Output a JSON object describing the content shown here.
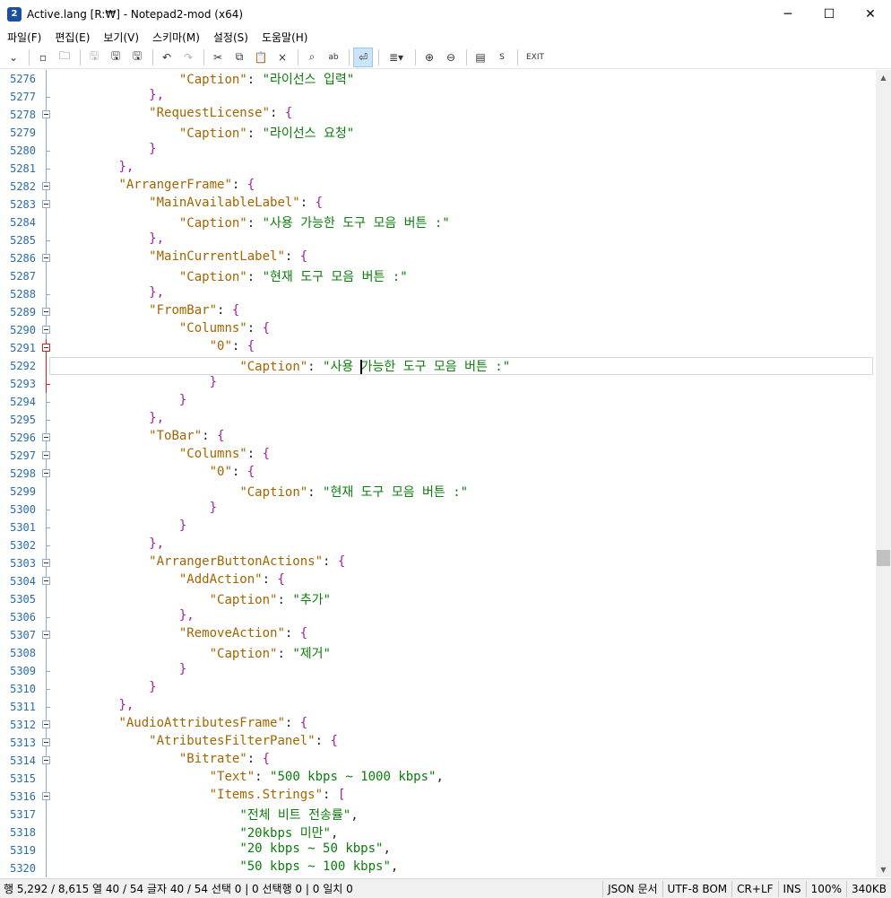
{
  "window": {
    "title": "Active.lang [R:₩] - Notepad2-mod (x64)",
    "app_icon_text": "2",
    "controls": {
      "minimize": "─",
      "maximize": "☐",
      "close": "✕"
    }
  },
  "menu": [
    "파일(F)",
    "편집(E)",
    "보기(V)",
    "스키마(M)",
    "설정(S)",
    "도움말(H)"
  ],
  "toolbar": {
    "dropdown_icon": "⌄",
    "new_icon": "▫",
    "open_icon": "🗀",
    "save_disabled_icon": "🖫",
    "save_icon": "🖫",
    "save_as_icon": "🖫",
    "undo_icon": "↶",
    "redo_icon": "↷",
    "cut_icon": "✂",
    "copy_icon": "⧉",
    "paste_icon": "📋",
    "delete_icon": "×",
    "find_icon": "⌕",
    "replace_icon": "ab",
    "wordwrap_icon": "⏎",
    "schema_icon": "≣▾",
    "zoom_in_icon": "⊕",
    "zoom_out_icon": "⊖",
    "settings_icon": "▤",
    "s_label": "S",
    "exit_label": "EXIT"
  },
  "editor": {
    "lines": [
      {
        "num": "5276",
        "fold": "line",
        "indent": 16,
        "key": "\"Caption\"",
        "sep": ": ",
        "value": "\"라이선스 입력\"",
        "tail": ""
      },
      {
        "num": "5277",
        "fold": "end",
        "indent": 12,
        "key": "",
        "sep": "",
        "value": "",
        "tail": "},"
      },
      {
        "num": "5278",
        "fold": "box",
        "indent": 12,
        "key": "\"RequestLicense\"",
        "sep": ": ",
        "value": "",
        "tail": "{"
      },
      {
        "num": "5279",
        "fold": "line",
        "indent": 16,
        "key": "\"Caption\"",
        "sep": ": ",
        "value": "\"라이선스 요청\"",
        "tail": ""
      },
      {
        "num": "5280",
        "fold": "end",
        "indent": 12,
        "key": "",
        "sep": "",
        "value": "",
        "tail": "}"
      },
      {
        "num": "5281",
        "fold": "end",
        "indent": 8,
        "key": "",
        "sep": "",
        "value": "",
        "tail": "},"
      },
      {
        "num": "5282",
        "fold": "box",
        "indent": 8,
        "key": "\"ArrangerFrame\"",
        "sep": ": ",
        "value": "",
        "tail": "{"
      },
      {
        "num": "5283",
        "fold": "box",
        "indent": 12,
        "key": "\"MainAvailableLabel\"",
        "sep": ": ",
        "value": "",
        "tail": "{"
      },
      {
        "num": "5284",
        "fold": "line",
        "indent": 16,
        "key": "\"Caption\"",
        "sep": ": ",
        "value": "\"사용 가능한 도구 모음 버튼 :\"",
        "tail": ""
      },
      {
        "num": "5285",
        "fold": "end",
        "indent": 12,
        "key": "",
        "sep": "",
        "value": "",
        "tail": "},"
      },
      {
        "num": "5286",
        "fold": "box",
        "indent": 12,
        "key": "\"MainCurrentLabel\"",
        "sep": ": ",
        "value": "",
        "tail": "{"
      },
      {
        "num": "5287",
        "fold": "line",
        "indent": 16,
        "key": "\"Caption\"",
        "sep": ": ",
        "value": "\"현재 도구 모음 버튼 :\"",
        "tail": ""
      },
      {
        "num": "5288",
        "fold": "end",
        "indent": 12,
        "key": "",
        "sep": "",
        "value": "",
        "tail": "},"
      },
      {
        "num": "5289",
        "fold": "box",
        "indent": 12,
        "key": "\"FromBar\"",
        "sep": ": ",
        "value": "",
        "tail": "{"
      },
      {
        "num": "5290",
        "fold": "box",
        "indent": 16,
        "key": "\"Columns\"",
        "sep": ": ",
        "value": "",
        "tail": "{"
      },
      {
        "num": "5291",
        "fold": "boxred",
        "indent": 20,
        "key": "\"0\"",
        "sep": ": ",
        "value": "",
        "tail": "{"
      },
      {
        "num": "5292",
        "fold": "linered",
        "indent": 24,
        "key": "\"Caption\"",
        "sep": ": ",
        "value": "\"사용 ",
        "caret": true,
        "value2": "가능한 도구 모음 버튼 :\"",
        "tail": "",
        "current": true
      },
      {
        "num": "5293",
        "fold": "endred",
        "indent": 20,
        "key": "",
        "sep": "",
        "value": "",
        "tail": "}"
      },
      {
        "num": "5294",
        "fold": "end",
        "indent": 16,
        "key": "",
        "sep": "",
        "value": "",
        "tail": "}"
      },
      {
        "num": "5295",
        "fold": "end",
        "indent": 12,
        "key": "",
        "sep": "",
        "value": "",
        "tail": "},"
      },
      {
        "num": "5296",
        "fold": "box",
        "indent": 12,
        "key": "\"ToBar\"",
        "sep": ": ",
        "value": "",
        "tail": "{"
      },
      {
        "num": "5297",
        "fold": "box",
        "indent": 16,
        "key": "\"Columns\"",
        "sep": ": ",
        "value": "",
        "tail": "{"
      },
      {
        "num": "5298",
        "fold": "box",
        "indent": 20,
        "key": "\"0\"",
        "sep": ": ",
        "value": "",
        "tail": "{"
      },
      {
        "num": "5299",
        "fold": "line",
        "indent": 24,
        "key": "\"Caption\"",
        "sep": ": ",
        "value": "\"현재 도구 모음 버튼 :\"",
        "tail": ""
      },
      {
        "num": "5300",
        "fold": "end",
        "indent": 20,
        "key": "",
        "sep": "",
        "value": "",
        "tail": "}"
      },
      {
        "num": "5301",
        "fold": "end",
        "indent": 16,
        "key": "",
        "sep": "",
        "value": "",
        "tail": "}"
      },
      {
        "num": "5302",
        "fold": "end",
        "indent": 12,
        "key": "",
        "sep": "",
        "value": "",
        "tail": "},"
      },
      {
        "num": "5303",
        "fold": "box",
        "indent": 12,
        "key": "\"ArrangerButtonActions\"",
        "sep": ": ",
        "value": "",
        "tail": "{"
      },
      {
        "num": "5304",
        "fold": "box",
        "indent": 16,
        "key": "\"AddAction\"",
        "sep": ": ",
        "value": "",
        "tail": "{"
      },
      {
        "num": "5305",
        "fold": "line",
        "indent": 20,
        "key": "\"Caption\"",
        "sep": ": ",
        "value": "\"추가\"",
        "tail": ""
      },
      {
        "num": "5306",
        "fold": "end",
        "indent": 16,
        "key": "",
        "sep": "",
        "value": "",
        "tail": "},"
      },
      {
        "num": "5307",
        "fold": "box",
        "indent": 16,
        "key": "\"RemoveAction\"",
        "sep": ": ",
        "value": "",
        "tail": "{"
      },
      {
        "num": "5308",
        "fold": "line",
        "indent": 20,
        "key": "\"Caption\"",
        "sep": ": ",
        "value": "\"제거\"",
        "tail": ""
      },
      {
        "num": "5309",
        "fold": "end",
        "indent": 16,
        "key": "",
        "sep": "",
        "value": "",
        "tail": "}"
      },
      {
        "num": "5310",
        "fold": "end",
        "indent": 12,
        "key": "",
        "sep": "",
        "value": "",
        "tail": "}"
      },
      {
        "num": "5311",
        "fold": "end",
        "indent": 8,
        "key": "",
        "sep": "",
        "value": "",
        "tail": "},"
      },
      {
        "num": "5312",
        "fold": "box",
        "indent": 8,
        "key": "\"AudioAttributesFrame\"",
        "sep": ": ",
        "value": "",
        "tail": "{"
      },
      {
        "num": "5313",
        "fold": "box",
        "indent": 12,
        "key": "\"AtributesFilterPanel\"",
        "sep": ": ",
        "value": "",
        "tail": "{"
      },
      {
        "num": "5314",
        "fold": "box",
        "indent": 16,
        "key": "\"Bitrate\"",
        "sep": ": ",
        "value": "",
        "tail": "{"
      },
      {
        "num": "5315",
        "fold": "line",
        "indent": 20,
        "key": "\"Text\"",
        "sep": ": ",
        "value": "\"500 kbps ~ 1000 kbps\"",
        "tail": ","
      },
      {
        "num": "5316",
        "fold": "box",
        "indent": 20,
        "key": "\"Items.Strings\"",
        "sep": ": ",
        "value": "",
        "tail": "["
      },
      {
        "num": "5317",
        "fold": "line",
        "indent": 24,
        "key": "",
        "sep": "",
        "value": "\"전체 비트 전송률\"",
        "tail": ","
      },
      {
        "num": "5318",
        "fold": "line",
        "indent": 24,
        "key": "",
        "sep": "",
        "value": "\"20kbps 미만\"",
        "tail": ","
      },
      {
        "num": "5319",
        "fold": "line",
        "indent": 24,
        "key": "",
        "sep": "",
        "value": "\"20 kbps ~ 50 kbps\"",
        "tail": ","
      },
      {
        "num": "5320",
        "fold": "line",
        "indent": 24,
        "key": "",
        "sep": "",
        "value": "\"50 kbps ~ 100 kbps\"",
        "tail": ","
      }
    ]
  },
  "status": {
    "position": "행 5,292 / 8,615  열 40 / 54  글자 40 / 54  선택 0 | 0  선택행 0 | 0  일치 0",
    "schema": "JSON 문서",
    "encoding": "UTF-8 BOM",
    "eol": "CR+LF",
    "ins": "INS",
    "zoom": "100%",
    "size": "340KB"
  }
}
